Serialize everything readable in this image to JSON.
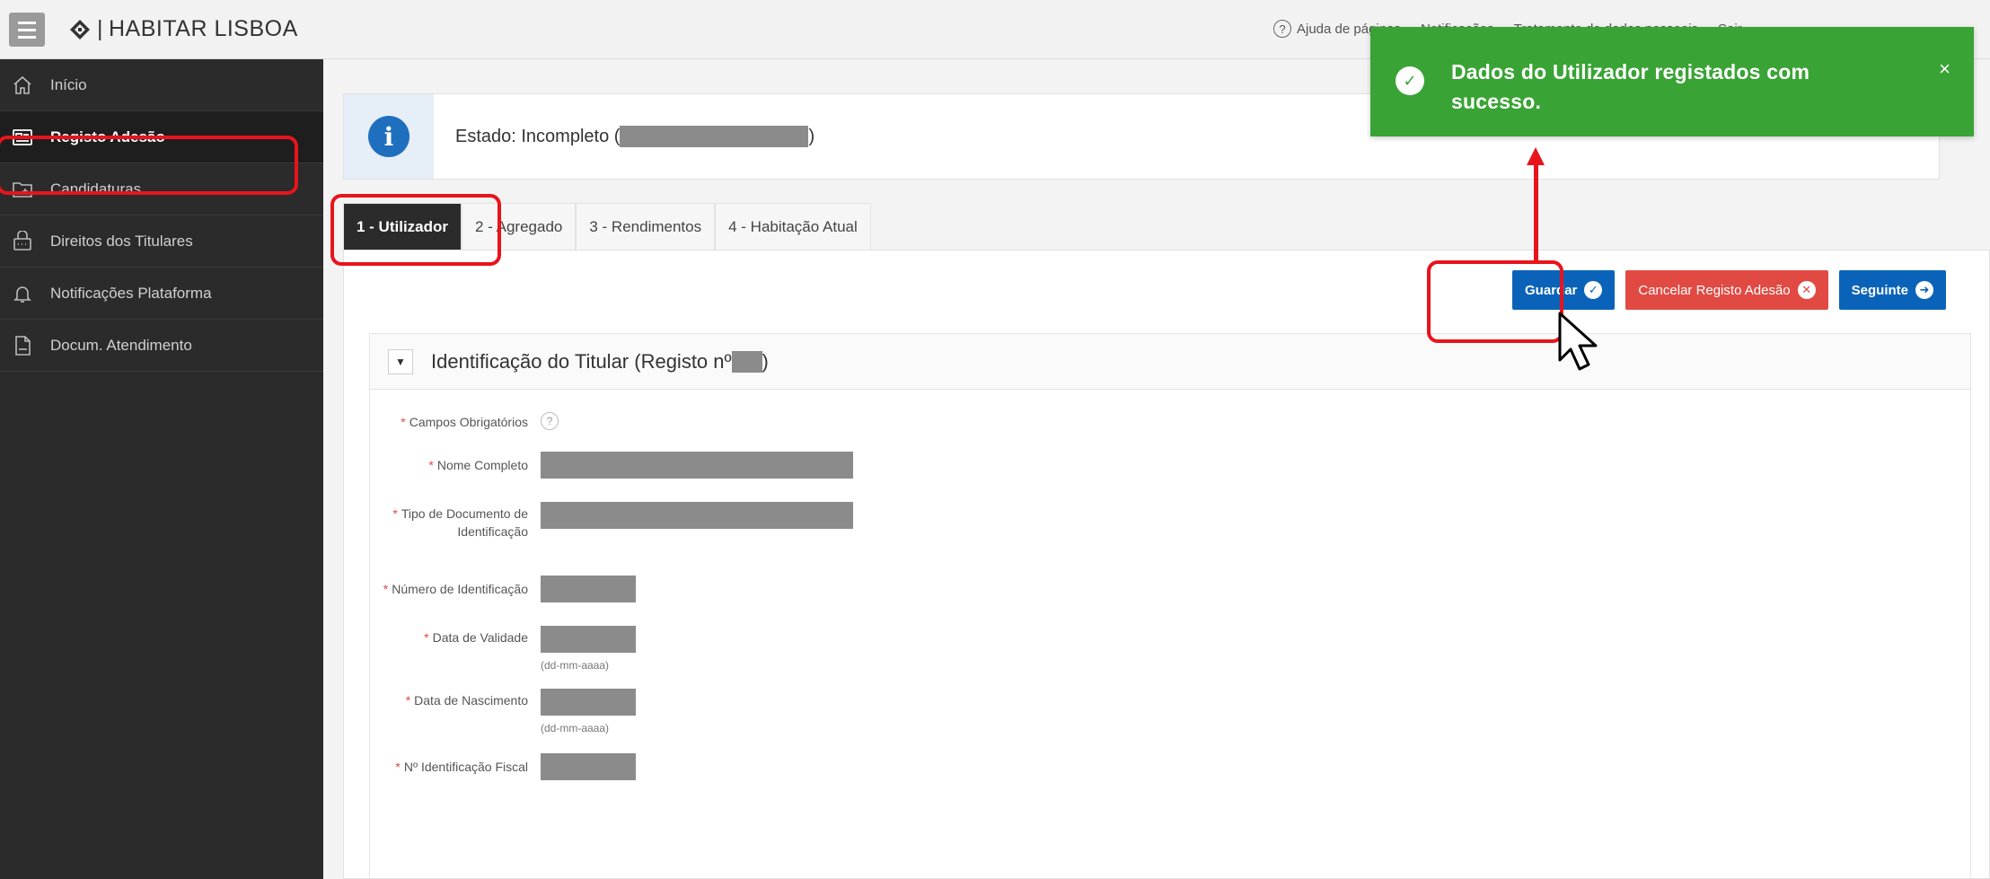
{
  "header": {
    "brand": "HABITAR LISBOA",
    "nav": [
      "Ajuda de páginas",
      "Notificações",
      "Tratamento de dados pessoais",
      "Sair"
    ]
  },
  "sidebar": {
    "items": [
      {
        "label": "Início",
        "icon": "home-icon"
      },
      {
        "label": "Registo Adesão",
        "icon": "id-card-icon"
      },
      {
        "label": "Candidaturas",
        "icon": "folder-icon"
      },
      {
        "label": "Direitos dos Titulares",
        "icon": "briefcase-icon"
      },
      {
        "label": "Notificações Plataforma",
        "icon": "bell-icon"
      },
      {
        "label": "Docum. Atendimento",
        "icon": "document-icon"
      }
    ]
  },
  "status": {
    "label": "Estado: Incompleto (",
    "close_paren": ")"
  },
  "tabs": [
    "1 - Utilizador",
    "2 - Agregado",
    "3 - Rendimentos",
    "4 - Habitação Atual"
  ],
  "buttons": {
    "save": "Guardar",
    "cancel": "Cancelar Registo Adesão",
    "next": "Seguinte"
  },
  "region": {
    "title_prefix": "Identificação do Titular (Registo nº",
    "title_suffix": ")"
  },
  "form": {
    "required_note": "Campos Obrigatórios",
    "fields": [
      {
        "label": "Nome Completo"
      },
      {
        "label": "Tipo de Documento de Identificação"
      },
      {
        "label": "Número de Identificação"
      },
      {
        "label": "Data de Validade",
        "hint": "(dd-mm-aaaa)"
      },
      {
        "label": "Data de Nascimento",
        "hint": "(dd-mm-aaaa)"
      },
      {
        "label": "Nº Identificação Fiscal"
      }
    ]
  },
  "toast": {
    "message": "Dados do Utilizador registados com sucesso.",
    "close": "×"
  },
  "colors": {
    "primary": "#0a63b8",
    "danger": "#e04a43",
    "success": "#3aa335",
    "sidebar": "#2b2b2b",
    "annotation": "#e8141c"
  }
}
